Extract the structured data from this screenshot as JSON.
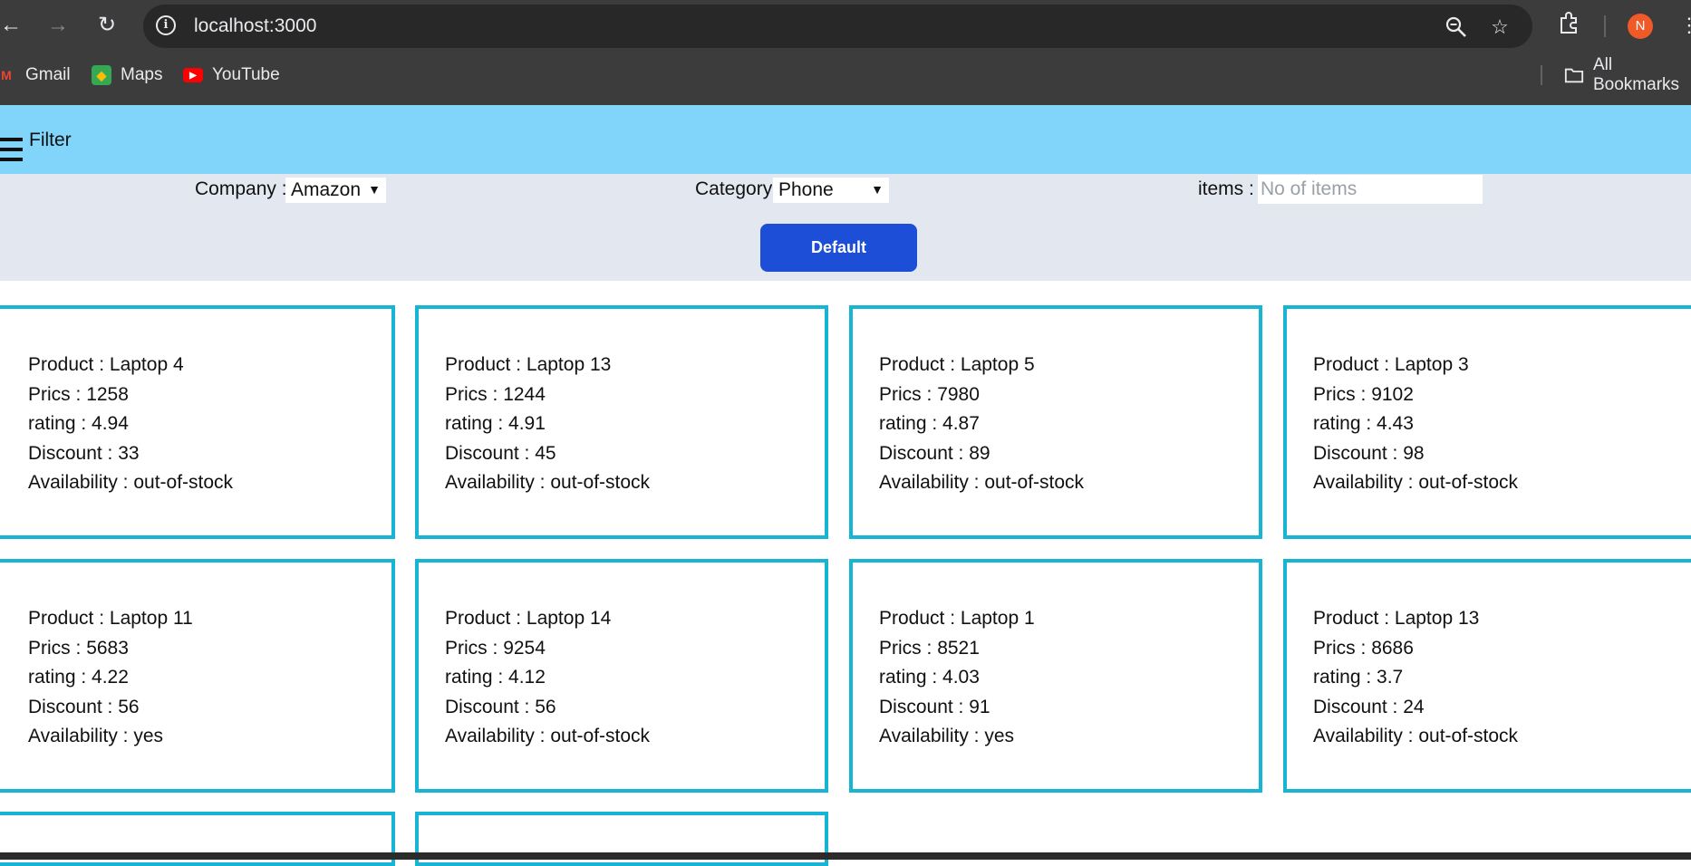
{
  "browser": {
    "url": "localhost:3000",
    "profile_initial": "N",
    "bookmarks": [
      {
        "label": "Gmail",
        "icon": "gmail-icon"
      },
      {
        "label": "Maps",
        "icon": "maps-icon"
      },
      {
        "label": "YouTube",
        "icon": "youtube-icon"
      }
    ],
    "all_bookmarks_label": "All Bookmarks"
  },
  "app": {
    "header": {
      "title": "Filter"
    },
    "filters": {
      "company_label": "Company :",
      "company_value": "Amazon",
      "category_label": "Category",
      "category_value": "Phone",
      "items_label": "items :",
      "items_placeholder": "No of items",
      "default_button": "Default"
    },
    "field_labels": {
      "product": "Product :",
      "price": "Prics :",
      "rating": "rating :",
      "discount": "Discount :",
      "availability": "Availability :"
    },
    "products": [
      {
        "name": "Laptop 4",
        "price": "1258",
        "rating": "4.94",
        "discount": "33",
        "availability": "out-of-stock"
      },
      {
        "name": "Laptop 13",
        "price": "1244",
        "rating": "4.91",
        "discount": "45",
        "availability": "out-of-stock"
      },
      {
        "name": "Laptop 5",
        "price": "7980",
        "rating": "4.87",
        "discount": "89",
        "availability": "out-of-stock"
      },
      {
        "name": "Laptop 3",
        "price": "9102",
        "rating": "4.43",
        "discount": "98",
        "availability": "out-of-stock"
      },
      {
        "name": "Laptop 11",
        "price": "5683",
        "rating": "4.22",
        "discount": "56",
        "availability": "yes"
      },
      {
        "name": "Laptop 14",
        "price": "9254",
        "rating": "4.12",
        "discount": "56",
        "availability": "out-of-stock"
      },
      {
        "name": "Laptop 1",
        "price": "8521",
        "rating": "4.03",
        "discount": "91",
        "availability": "yes"
      },
      {
        "name": "Laptop 13",
        "price": "8686",
        "rating": "3.7",
        "discount": "24",
        "availability": "out-of-stock"
      }
    ]
  },
  "colors": {
    "appbar": "#81d4fa",
    "filter_panel": "#e2e7f0",
    "card_border": "#18b4d4",
    "button": "#1d4ed8"
  }
}
